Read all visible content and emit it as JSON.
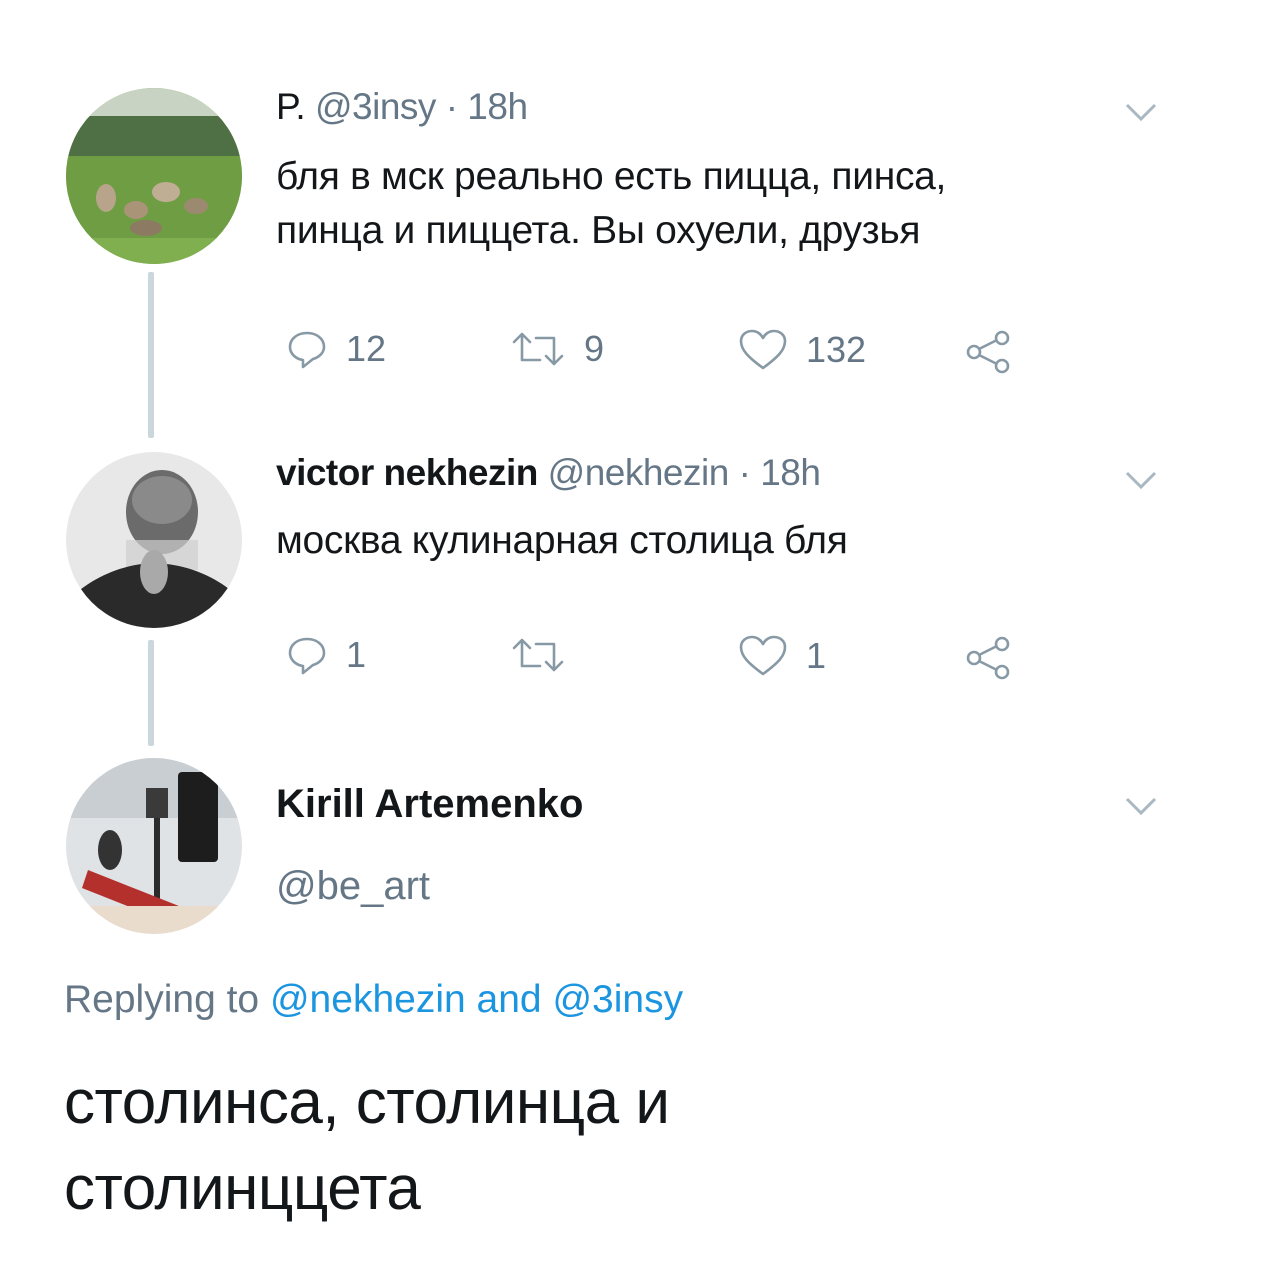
{
  "tweets": [
    {
      "name": "P.",
      "handle": "@3insy",
      "time": "· 18h",
      "text_line1": "бля в мск реально есть пицца, пинса,",
      "text_line2": "пинца и пиццета. Вы охуели, друзья",
      "replies": "12",
      "retweets": "9",
      "likes": "132"
    },
    {
      "name": "victor nekhezin",
      "handle": "@nekhezin",
      "time": "· 18h",
      "text_line1": "москва кулинарная столица бля",
      "replies": "1",
      "retweets": "",
      "likes": "1"
    }
  ],
  "focused": {
    "name": "Kirill Artemenko",
    "handle": "@be_art",
    "replying_prefix": "Replying to",
    "reply_handle1": "@nekhezin",
    "reply_and": "and",
    "reply_handle2": "@3insy",
    "text_line1": "столинса, столинца и",
    "text_line2": "столинццета"
  },
  "colors": {
    "text": "#14171a",
    "secondary": "#657786",
    "link": "#1b95e0",
    "thread_line": "#ccd6dd"
  },
  "icons": [
    "reply-icon",
    "retweet-icon",
    "like-icon",
    "share-icon",
    "chevron-down-icon"
  ]
}
